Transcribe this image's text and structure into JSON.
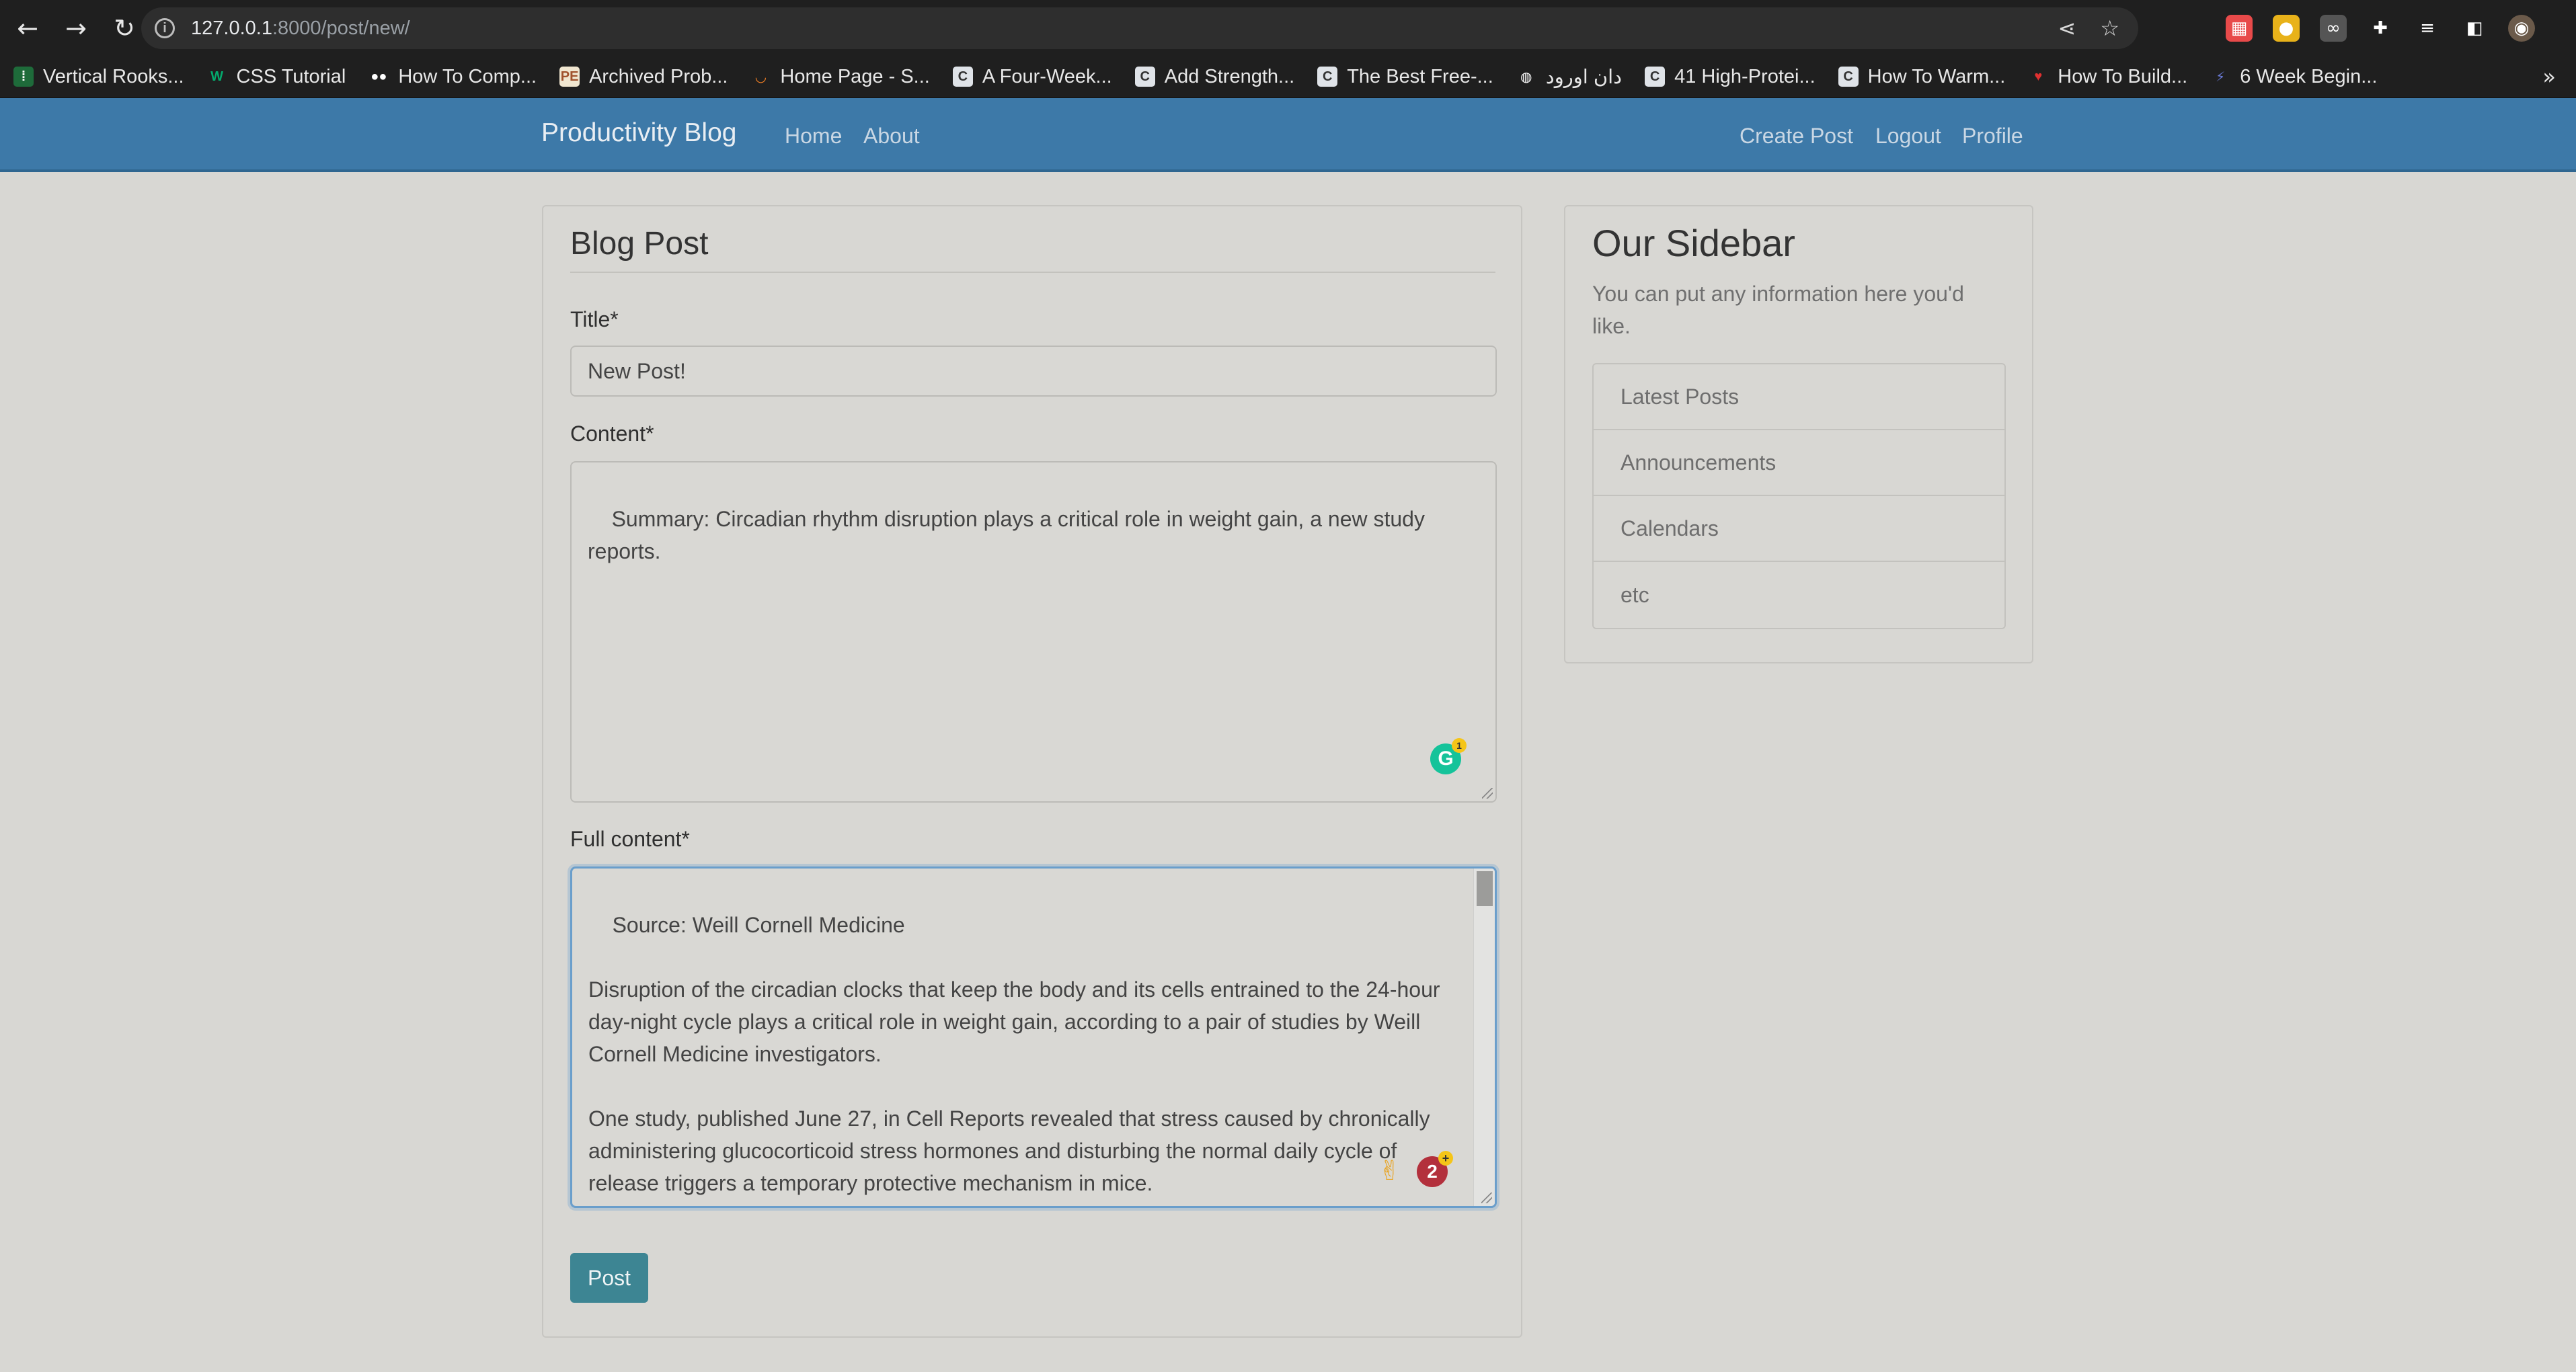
{
  "browser": {
    "url_host": "127.0.0.1",
    "url_path": ":8000/post/new/",
    "bookmarks": [
      {
        "label": "Vertical Rooks...",
        "icon": "kebab-icon"
      },
      {
        "label": "CSS Tutorial",
        "icon": "w3-icon"
      },
      {
        "label": "How To Comp...",
        "icon": "medium-icon"
      },
      {
        "label": "Archived Prob...",
        "icon": "pe-icon"
      },
      {
        "label": "Home Page - S...",
        "icon": "stackoverflow-icon"
      },
      {
        "label": "A Four-Week...",
        "icon": "c-icon"
      },
      {
        "label": "Add Strength...",
        "icon": "c-icon"
      },
      {
        "label": "The Best Free-...",
        "icon": "c-icon"
      },
      {
        "label": "دان اورود",
        "icon": "globe-icon"
      },
      {
        "label": "41 High-Protei...",
        "icon": "c-icon"
      },
      {
        "label": "How To Warm...",
        "icon": "c-icon"
      },
      {
        "label": "How To Build...",
        "icon": "heart-icon"
      },
      {
        "label": "6 Week Begin...",
        "icon": "runner-icon"
      }
    ]
  },
  "navbar": {
    "brand": "Productivity Blog",
    "home": "Home",
    "about": "About",
    "create_post": "Create Post",
    "logout": "Logout",
    "profile": "Profile"
  },
  "form": {
    "heading": "Blog Post",
    "title_label": "Title*",
    "title_value": "New Post!",
    "content_label": "Content*",
    "content_value": "Summary: Circadian rhythm disruption plays a critical role in weight gain, a new study reports.",
    "full_content_label": "Full content*",
    "full_content_value": "Source: Weill Cornell Medicine\n\nDisruption of the circadian clocks that keep the body and its cells entrained to the 24-hour day-night cycle plays a critical role in weight gain, according to a pair of studies by Weill Cornell Medicine investigators.\n\nOne study, published June 27, in Cell Reports revealed that stress caused by chronically administering glucocorticoid stress hormones and disturbing the normal daily cycle of release triggers a temporary protective mechanism in mice.",
    "grammarly_count": "1",
    "alert_count": "2",
    "submit_label": "Post"
  },
  "sidebar": {
    "title": "Our Sidebar",
    "text": "You can put any information here you'd like.",
    "items": [
      "Latest Posts",
      "Announcements",
      "Calendars",
      "etc"
    ]
  }
}
